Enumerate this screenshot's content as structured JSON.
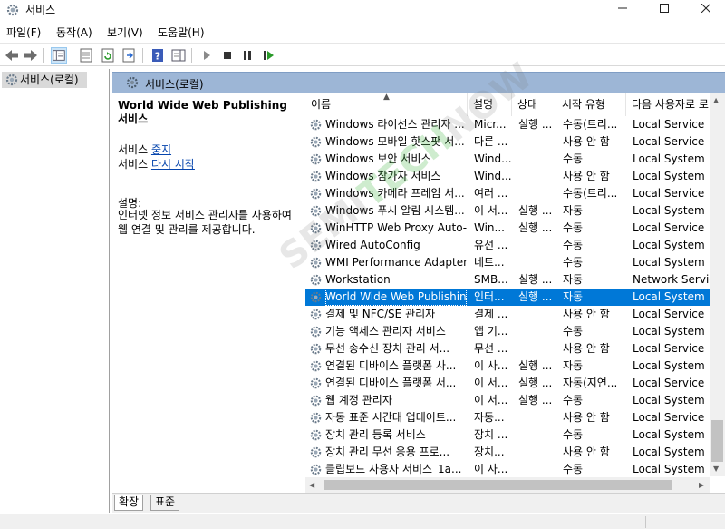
{
  "window": {
    "title": "서비스",
    "icon": "gear-icon"
  },
  "menu": [
    "파일(F)",
    "동작(A)",
    "보기(V)",
    "도움말(H)"
  ],
  "tree": {
    "root_label": "서비스(로컬)"
  },
  "main_header": {
    "label": "서비스(로컬)"
  },
  "description_panel": {
    "title": "World Wide Web Publishing 서비스",
    "stop_prefix": "서비스 ",
    "stop_link": "중지",
    "restart_prefix": "서비스 ",
    "restart_link": "다시 시작",
    "desc_label": "설명:",
    "desc_text": "인터넷 정보 서비스 관리자를 사용하여 웹 연결 및 관리를 제공합니다."
  },
  "columns": [
    "이름",
    "설명",
    "상태",
    "시작 유형",
    "다음 사용자로 로"
  ],
  "services": [
    {
      "name": "Windows 라이선스 관리자 ...",
      "desc": "Micr...",
      "status": "실행 ...",
      "start": "수동(트리...",
      "logon": "Local Service"
    },
    {
      "name": "Windows 모바일 핫스팟 서...",
      "desc": "다른 ...",
      "status": "",
      "start": "사용 안 함",
      "logon": "Local Service"
    },
    {
      "name": "Windows 보안 서비스",
      "desc": "Wind...",
      "status": "",
      "start": "수동",
      "logon": "Local System"
    },
    {
      "name": "Windows 참가자 서비스",
      "desc": "Wind...",
      "status": "",
      "start": "사용 안 함",
      "logon": "Local System"
    },
    {
      "name": "Windows 카메라 프레임 서...",
      "desc": "여러 ...",
      "status": "",
      "start": "수동(트리...",
      "logon": "Local Service"
    },
    {
      "name": "Windows 푸시 알림 시스템...",
      "desc": "이 서...",
      "status": "실행 ...",
      "start": "자동",
      "logon": "Local System"
    },
    {
      "name": "WinHTTP Web Proxy Auto-...",
      "desc": "Win...",
      "status": "실행 ...",
      "start": "수동",
      "logon": "Local Service"
    },
    {
      "name": "Wired AutoConfig",
      "desc": "유선 ...",
      "status": "",
      "start": "수동",
      "logon": "Local System"
    },
    {
      "name": "WMI Performance Adapter",
      "desc": "네트...",
      "status": "",
      "start": "수동",
      "logon": "Local System"
    },
    {
      "name": "Workstation",
      "desc": "SMB...",
      "status": "실행 ...",
      "start": "자동",
      "logon": "Network Service"
    },
    {
      "name": "World Wide Web Publishin...",
      "desc": "인터...",
      "status": "실행 ...",
      "start": "자동",
      "logon": "Local System",
      "selected": true
    },
    {
      "name": "결제 및 NFC/SE 관리자",
      "desc": "결제 ...",
      "status": "",
      "start": "사용 안 함",
      "logon": "Local Service"
    },
    {
      "name": "기능 액세스 관리자 서비스",
      "desc": "앱 기...",
      "status": "",
      "start": "수동",
      "logon": "Local System"
    },
    {
      "name": "무선 송수신 장치 관리 서...",
      "desc": "무선 ...",
      "status": "",
      "start": "사용 안 함",
      "logon": "Local Service"
    },
    {
      "name": "연결된 디바이스 플랫폼 사...",
      "desc": "이 사...",
      "status": "실행 ...",
      "start": "자동",
      "logon": "Local System"
    },
    {
      "name": "연결된 디바이스 플랫폼 서...",
      "desc": "이 서...",
      "status": "실행 ...",
      "start": "자동(지연...",
      "logon": "Local Service"
    },
    {
      "name": "웹 계정 관리자",
      "desc": "이 서...",
      "status": "실행 ...",
      "start": "수동",
      "logon": "Local System"
    },
    {
      "name": "자동 표준 시간대 업데이트...",
      "desc": "자동...",
      "status": "",
      "start": "사용 안 함",
      "logon": "Local Service"
    },
    {
      "name": "장치 관리 등록 서비스",
      "desc": "장치 ...",
      "status": "",
      "start": "수동",
      "logon": "Local System"
    },
    {
      "name": "장치 관리 무선 응용 프로...",
      "desc": "장치...",
      "status": "",
      "start": "사용 안 함",
      "logon": "Local System"
    },
    {
      "name": "클립보드 사용자 서비스_1a...",
      "desc": "이 사...",
      "status": "",
      "start": "수동",
      "logon": "Local System"
    }
  ],
  "tabs": [
    "확장",
    "표준"
  ],
  "watermark": {
    "line1": "SEMI",
    "line2": "TECH",
    "line3": "NOW"
  }
}
